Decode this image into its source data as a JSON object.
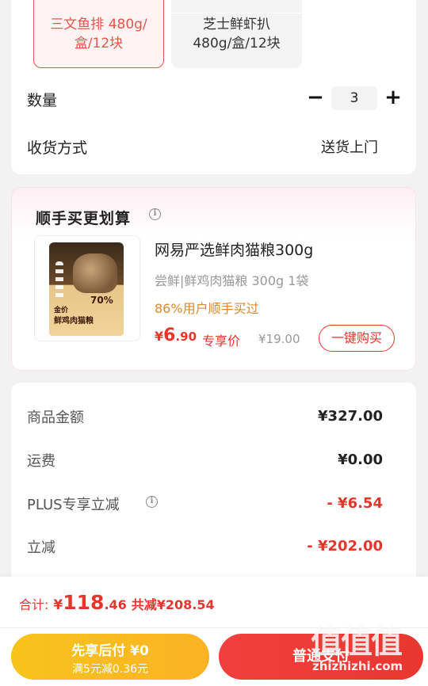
{
  "specs": {
    "selected": "三文鱼排 480g/\n盒/12块",
    "other": "芝士鲜虾扒\n480g/盒/12块"
  },
  "quantity": {
    "label": "数量",
    "value": "3",
    "minus": "−",
    "plus": "+"
  },
  "delivery": {
    "label": "收货方式",
    "value": "送货上门"
  },
  "addon": {
    "title": "顺手买更划算",
    "info": "i",
    "product": {
      "name": "网易严选鲜肉猫粮300g",
      "subtitle": "尝鲜|鲜鸡肉猫粮 300g 1袋",
      "tag": "86%用户顺手买过",
      "price_currency": "¥",
      "price_int": "6",
      "price_dec": ".90",
      "price_label": "专享价",
      "original_price": "¥19.00",
      "buy_label": "一键购买",
      "image_text_1": "金价",
      "image_text_2": "鲜鸡肉猫粮",
      "image_pct": "70%"
    }
  },
  "fees": [
    {
      "label": "商品金额",
      "value": "¥327.00",
      "color": "#222222"
    },
    {
      "label": "运费",
      "value": "¥0.00",
      "color": "#222222"
    },
    {
      "label": "PLUS专享立减",
      "value": "- ¥6.54",
      "color": "#e8352b"
    },
    {
      "label": "立减",
      "value": "- ¥202.00",
      "color": "#e8352b"
    }
  ],
  "footer": {
    "total_label": "合计:",
    "total_currency": "¥",
    "total_int": "118",
    "total_dec": ".46",
    "total_saved": "共减¥208.54",
    "later_pay_line1": "先享后付 ¥0",
    "later_pay_line2": "满5元减0.36元",
    "pay_label": "普通支付"
  },
  "watermark": {
    "glyphs": "值值值",
    "url": "zhizhizhi.com"
  },
  "colors": {
    "accent": "#e8352b",
    "later_pay": "#f7c31c",
    "tag": "#d9892e"
  }
}
